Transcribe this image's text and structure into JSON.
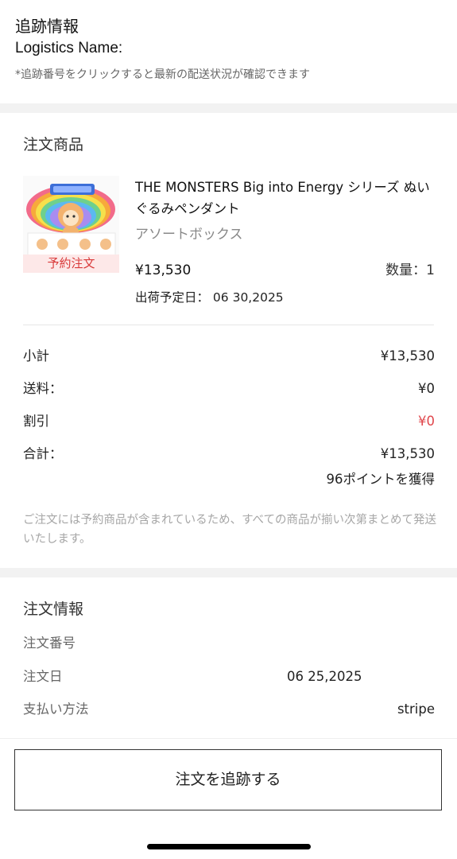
{
  "tracking": {
    "title": "追跡情報",
    "logistics_label": "Logistics Name:",
    "hint": "*追跡番号をクリックすると最新の配送状況が確認できます"
  },
  "items_section": {
    "title": "注文商品",
    "product": {
      "name": "THE MONSTERS Big into Energy シリーズ ぬいぐるみペンダント",
      "variant": "アソートボックス",
      "price": "¥13,530",
      "quantity": "数量：1",
      "ship_date": "出荷予定日： 06 30,2025",
      "badge": "予約注文"
    }
  },
  "summary": {
    "subtotal_label": "小計",
    "subtotal_value": "¥13,530",
    "shipping_label": "送料：",
    "shipping_value": "¥0",
    "discount_label": "割引",
    "discount_value": "¥0",
    "total_label": "合計：",
    "total_value": "¥13,530",
    "points": "96ポイントを獲得",
    "notice": "ご注文には予約商品が含まれているため、すべての商品が揃い次第まとめて発送いたします。"
  },
  "order_info": {
    "title": "注文情報",
    "order_number_label": "注文番号",
    "order_date_label": "注文日",
    "order_date_value": "06 25,2025",
    "payment_label": "支払い方法",
    "payment_value": "stripe"
  },
  "actions": {
    "track_button": "注文を追跡する"
  },
  "colors": {
    "accent_red": "#e0474c",
    "badge_bg": "#fde8e8",
    "separator": "#f2f2f2"
  }
}
